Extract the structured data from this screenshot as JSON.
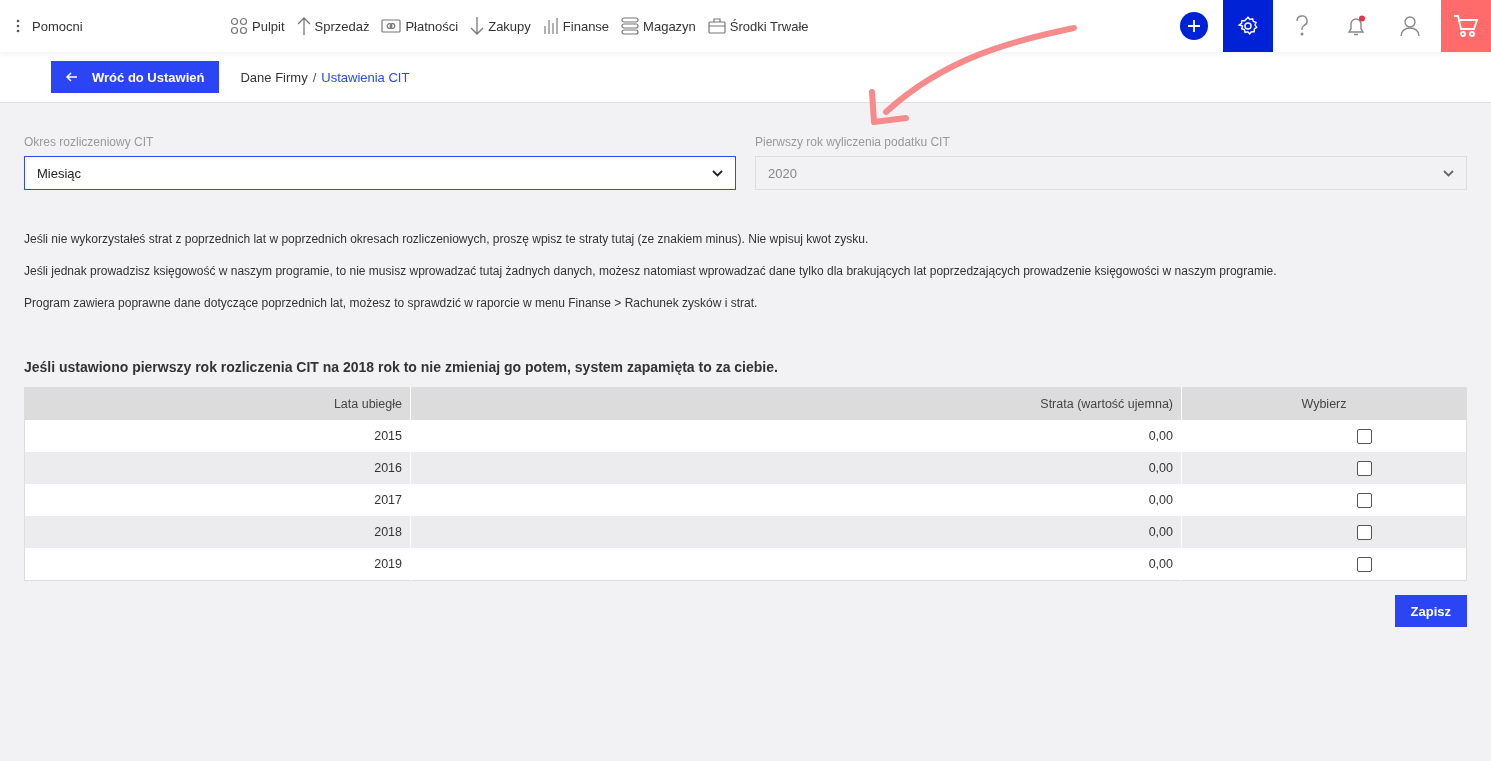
{
  "topbar": {
    "menu_label": "Pomocni",
    "nav": [
      "Pulpit",
      "Sprzedaż",
      "Płatności",
      "Zakupy",
      "Finanse",
      "Magazyn",
      "Środki Trwałe"
    ],
    "notification_unread": true,
    "settings_selected": true
  },
  "back_button": "Wróć do Ustawień",
  "breadcrumb": {
    "items": [
      "Dane Firmy",
      "Ustawienia CIT"
    ],
    "separator": "/"
  },
  "fields": [
    {
      "label": "Okres rozliczeniowy CIT",
      "value": "Miesiąc",
      "disabled": false
    },
    {
      "label": "Pierwszy rok wyliczenia podatku CIT",
      "value": "2020",
      "disabled": true
    }
  ],
  "paragraphs": [
    "Jeśli nie wykorzystałeś strat z poprzednich lat w poprzednich okresach rozliczeniowych, proszę wpisz te straty tutaj (ze znakiem minus). Nie wpisuj kwot zysku.",
    "Jeśli jednak prowadzisz księgowość w naszym programie, to nie musisz wprowadzać tutaj żadnych danych, możesz natomiast wprowadzać dane tylko dla brakujących lat poprzedzających prowadzenie księgowości w naszym programie.",
    "Program zawiera poprawne dane dotyczące poprzednich lat, możesz to sprawdzić w raporcie w menu Finanse > Rachunek zysków i strat."
  ],
  "table_heading": "Jeśli ustawiono pierwszy rok rozliczenia CIT na 2018 rok to nie zmieniaj go potem, system zapamięta to za ciebie.",
  "table": {
    "columns": [
      "Lata ubiegłe",
      "Strata (wartość ujemna)",
      "Wybierz"
    ],
    "rows": [
      {
        "year": "2015",
        "loss": "0,00",
        "checked": false
      },
      {
        "year": "2016",
        "loss": "0,00",
        "checked": false
      },
      {
        "year": "2017",
        "loss": "0,00",
        "checked": false
      },
      {
        "year": "2018",
        "loss": "0,00",
        "checked": false
      },
      {
        "year": "2019",
        "loss": "0,00",
        "checked": false
      }
    ]
  },
  "save_button": "Zapisz"
}
